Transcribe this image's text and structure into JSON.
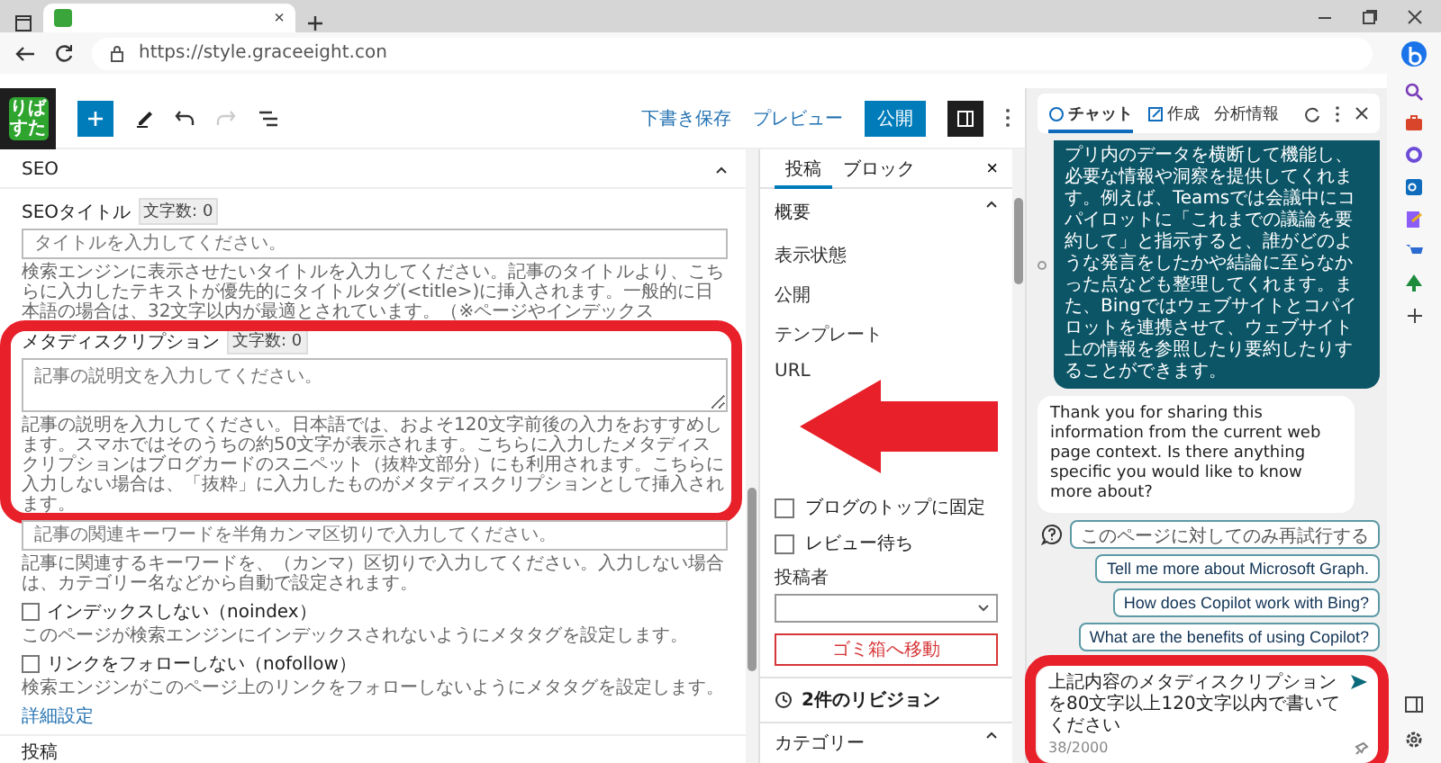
{
  "browser": {
    "tab_close": "×",
    "url": "https://style.graceeight.con"
  },
  "editor": {
    "logo_text": "りばすた",
    "save_draft": "下書き保存",
    "preview": "プレビュー",
    "publish": "公開",
    "redo_disabled": true
  },
  "seo": {
    "title": "SEO",
    "fields": [
      {
        "kind": "input",
        "label": "SEOタイトル",
        "count": "文字数: 0",
        "placeholder": "タイトルを入力してください。",
        "help": "検索エンジンに表示させたいタイトルを入力してください。記事のタイトルより、こちらに入力したテキストが優先的にタイトルタグ(<title>)に挿入されます。一般的に日本語の場合は、32文字以内が最適とされています。（※ページやインデックス",
        "highlighted": false
      },
      {
        "kind": "textarea",
        "label": "メタディスクリプション",
        "count": "文字数: 0",
        "placeholder": "記事の説明文を入力してください。",
        "help": "記事の説明を入力してください。日本語では、およそ120文字前後の入力をおすすめします。スマホではそのうちの約50文字が表示されます。こちらに入力したメタディスクリプションはブログカードのスニペット（抜粋文部分）にも利用されます。こちらに入力しない場合は、「抜粋」に入力したものがメタディスクリプションとして挿入されます。",
        "highlighted": true
      },
      {
        "kind": "input",
        "placeholder": "記事の関連キーワードを半角カンマ区切りで入力してください。",
        "help": "記事に関連するキーワードを、（カンマ）区切りで入力してください。入力しない場合は、カテゴリー名などから自動で設定されます。",
        "highlighted": false
      }
    ],
    "checkboxes": [
      {
        "label": "インデックスしない（noindex）",
        "note": "このページが検索エンジンにインデックスされないようにメタタグを設定します。",
        "checked": false
      },
      {
        "label": "リンクをフォローしない（nofollow）",
        "note": "検索エンジンがこのページ上のリンクをフォローしないようにメタタグを設定します。",
        "checked": false
      }
    ],
    "link": "詳細設定",
    "footer": "投稿"
  },
  "settings": {
    "tabs": [
      {
        "label": "投稿",
        "selected": true
      },
      {
        "label": "ブロック",
        "selected": false
      }
    ],
    "close": "×",
    "section": "概要",
    "rows": [
      "表示状態",
      "公開",
      "テンプレート",
      "URL"
    ],
    "checkboxes": [
      {
        "label": "ブログのトップに固定",
        "checked": false
      },
      {
        "label": "レビュー待ち",
        "checked": false
      }
    ],
    "author_label": "投稿者",
    "trash": "ゴミ箱へ移動",
    "revisions": "2件のリビジョン",
    "category": "カテゴリー"
  },
  "copilot": {
    "tabs": [
      {
        "label": "チャット",
        "selected": true
      },
      {
        "label": "作成",
        "selected": false
      },
      {
        "label": "分析情報",
        "selected": false
      }
    ],
    "messages": [
      {
        "kind": "user",
        "text": "プリ内のデータを横断して機能し、必要な情報や洞察を提供してくれます。例えば、Teamsでは会議中にコパイロットに「これまでの議論を要約して」と指示すると、誰がどのような発言をしたかや結論に至らなかった点なども整理してくれます。また、Bingではウェブサイトとコパイロットを連携させて、ウェブサイト上の情報を参照したり要約したりすることができます。"
      },
      {
        "kind": "bot",
        "text": "Thank you for sharing this information from the current web page context. Is there anything specific you would like to know more about?"
      }
    ],
    "suggestions": [
      "このページに対してのみ再試行する",
      "Tell me more about Microsoft Graph.",
      "How does Copilot work with Bing?",
      "What are the benefits of using Copilot?"
    ],
    "input": {
      "value": "上記内容のメタディスクリプションを80文字以上120文字以内で書いてください",
      "counter": "38/2000",
      "highlighted": true
    }
  }
}
